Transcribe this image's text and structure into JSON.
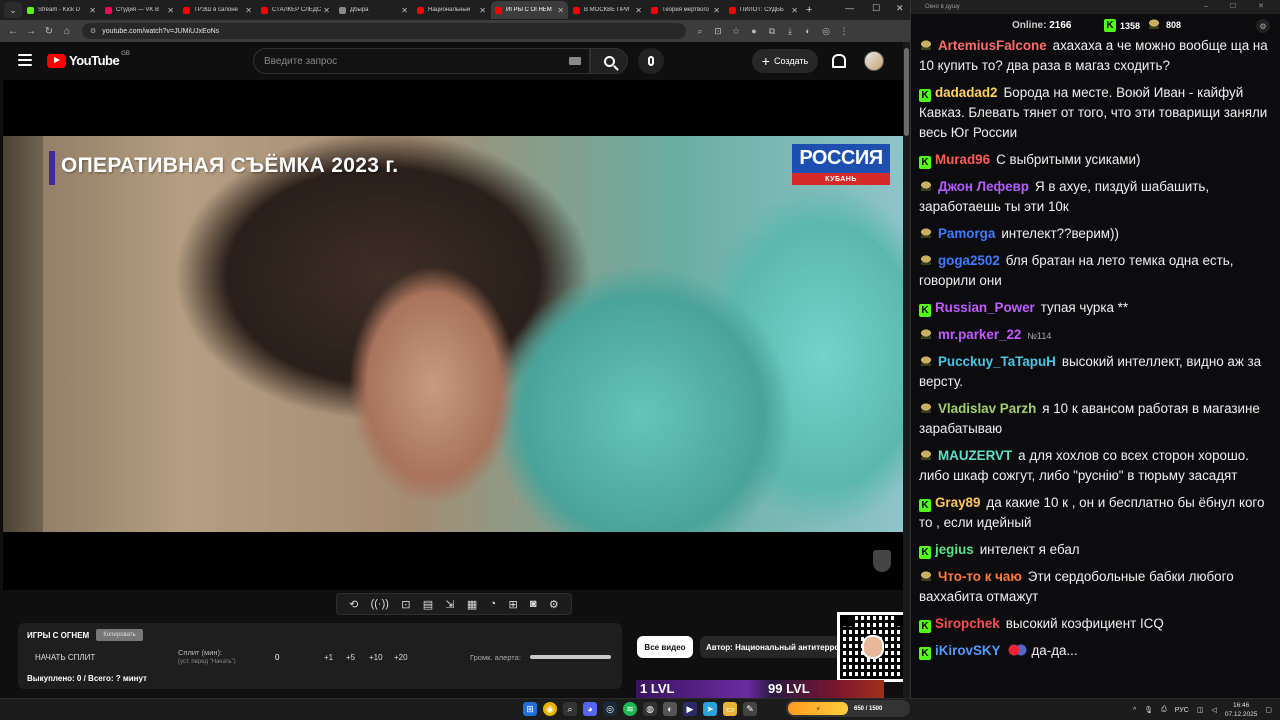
{
  "browser": {
    "tabs": [
      {
        "label": "Stream - Kick D",
        "color": "#53fc18",
        "active": false
      },
      {
        "label": "Студия — VK В",
        "color": "#ff0055",
        "active": false
      },
      {
        "label": "ТРЭШ в салоне",
        "color": "#ff0000",
        "active": false
      },
      {
        "label": "СТАЛКЕР СЛЕДС",
        "color": "#ff0000",
        "active": false
      },
      {
        "label": "Дбыра",
        "color": "#888888",
        "active": false
      },
      {
        "label": "Национальный",
        "color": "#ff0000",
        "active": false
      },
      {
        "label": "ИГРЫ С ОГНЕМ",
        "color": "#ff0000",
        "active": true
      },
      {
        "label": "В МОСКВЕ ПРИ",
        "color": "#ff0000",
        "active": false
      },
      {
        "label": "Теория мертвого",
        "color": "#ff0000",
        "active": false
      },
      {
        "label": "ПИЛОТ: СУДЬБ",
        "color": "#ff0000",
        "active": false
      }
    ],
    "url": "youtube.com/watch?v=JUMiUJxEoNs"
  },
  "youtube": {
    "logo_text": "YouTube",
    "region": "GB",
    "search_placeholder": "Введите запрос",
    "create_label": "Создать"
  },
  "video": {
    "overlay_title": "ОПЕРАТИВНАЯ СЪЁМКА 2023 г.",
    "channel_logo_top": "РОССИЯ",
    "channel_logo_bottom": "КУБАНЬ"
  },
  "player_tools": [
    "⟲",
    "((·))",
    "⊡",
    "▤",
    "⇲",
    "▦",
    "◔",
    "⊞",
    "◙",
    "⚙"
  ],
  "fire_panel": {
    "title": "ИГРЫ С ОГНЕМ",
    "copy_label": "Копировать",
    "start_split": "НАЧАТЬ СПЛИТ",
    "split_label": "Сплит (мин):",
    "split_sub": "(уст. перед \"Начать\")",
    "split_value": "0",
    "increments": [
      "+1",
      "+5",
      "+10",
      "+20"
    ],
    "volume_label": "Громк. алерта:",
    "sold": "Выкуплено: 0 / Всего: ? минут"
  },
  "chips": {
    "all_videos": "Все видео",
    "author": "Автор: Национальный антитеррор"
  },
  "levels": {
    "left": "1 LVL",
    "right": "99 LVL"
  },
  "chat": {
    "window_title": "Окно в душу",
    "online_label": "Online:",
    "online_value": "2166",
    "kick_count": "1358",
    "other_count": "808",
    "messages": [
      {
        "platform": "helm",
        "user": "ArtemiusFalcone",
        "color": "#ff6b6b",
        "text": "ахахаха а че можно вообще ща на 10 купить то? два раза в магаз сходить?"
      },
      {
        "platform": "kick",
        "user": "dadadad2",
        "color": "#ffd35c",
        "text": "Борода на месте. Воюй Иван - кайфуй Кавказ. Блевать тянет от того, что эти товарищи заняли весь Юг России"
      },
      {
        "platform": "kick",
        "user": "Murad96",
        "color": "#ff5a5a",
        "text": "С выбритыми усиками)"
      },
      {
        "platform": "helm",
        "user": "Джон Лефевр",
        "color": "#b35cff",
        "text": "Я в ахуе, пиздуй шабашить, заработаешь ты эти 10к"
      },
      {
        "platform": "helm",
        "user": "Pamorga",
        "color": "#3f7cff",
        "text": "интелект??верим))"
      },
      {
        "platform": "helm",
        "user": "goga2502",
        "color": "#3f7cff",
        "text": "бля братан на лето темка одна есть, говорили они"
      },
      {
        "platform": "kick",
        "user": "Russian_Power",
        "color": "#c15cff",
        "text": "тупая чурка **"
      },
      {
        "platform": "helm",
        "user": "mr.parker_22",
        "color": "#c15cff",
        "text": "",
        "emote": "№114"
      },
      {
        "platform": "helm",
        "user": "Pucckuy_TaTapuH",
        "color": "#49c6e5",
        "text": "высокий интеллект, видно аж за версту."
      },
      {
        "platform": "helm",
        "user": "Vladislav Parzh",
        "color": "#a4d06b",
        "text": "я 10 к авансом работая в магазине зарабатываю"
      },
      {
        "platform": "helm",
        "user": "MAUZERVT",
        "color": "#5ee0c4",
        "text": "а для хохлов со всех сторон хорошо. либо шкаф сожгут, либо \"руснію\" в тюрьму засадят"
      },
      {
        "platform": "kick",
        "user": "Gray89",
        "color": "#ffc65c",
        "text": "да какие 10 к , он и бесплатно бы ёбнул кого то , если идейный"
      },
      {
        "platform": "kick",
        "user": "jegius",
        "color": "#5ee08a",
        "text": "интелект я ебал"
      },
      {
        "platform": "helm",
        "user": "Что-то к чаю",
        "color": "#ff7a3c",
        "text": "Эти сердобольные бабки любого ваххабита отмажут"
      },
      {
        "platform": "kick",
        "user": "Siropchek",
        "color": "#ff4d4d",
        "text": "высокий коэфициент ICQ"
      },
      {
        "platform": "kick",
        "user": "iKirovSKY",
        "color": "#4f9bff",
        "text": "да-да...",
        "emote_img": true
      }
    ]
  },
  "taskbar": {
    "lang": "РУС",
    "time": "16:46",
    "date": "07.12.2025",
    "twitch_progress": "650 / 1500"
  },
  "colors": {
    "kick": "#53fc18",
    "youtube_red": "#ff0000",
    "russia_blue": "#1c4fb0",
    "russia_red": "#d62a2a"
  }
}
